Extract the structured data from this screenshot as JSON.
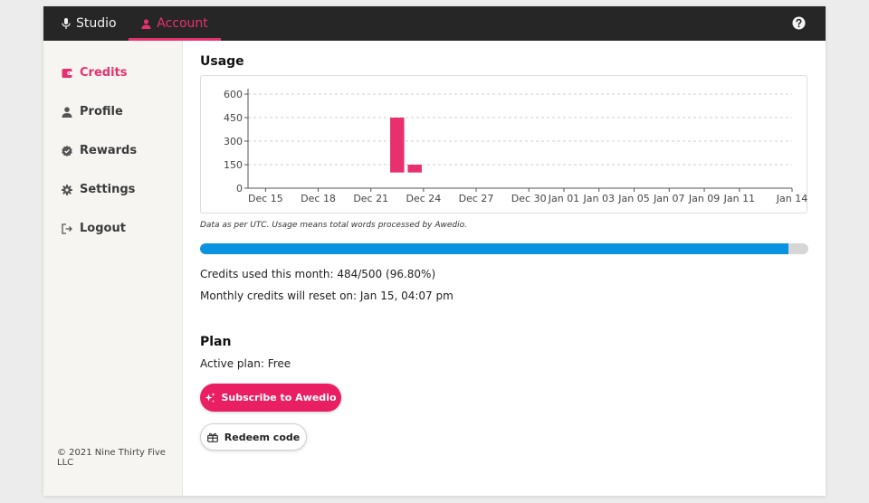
{
  "topbar": {
    "tabs": [
      {
        "label": "Studio",
        "icon": "microphone-icon"
      },
      {
        "label": "Account",
        "icon": "person-icon",
        "active": true
      }
    ],
    "help_icon": "help-icon"
  },
  "sidebar": {
    "items": [
      {
        "label": "Credits",
        "icon": "wallet-icon",
        "active": true
      },
      {
        "label": "Profile",
        "icon": "person-icon"
      },
      {
        "label": "Rewards",
        "icon": "badge-check-icon"
      },
      {
        "label": "Settings",
        "icon": "gear-icon"
      },
      {
        "label": "Logout",
        "icon": "logout-icon"
      }
    ],
    "copyright": "© 2021 Nine Thirty Five LLC"
  },
  "usage": {
    "title": "Usage",
    "note": "Data as per UTC. Usage means total words processed by Awedio.",
    "progress": {
      "used": 484,
      "total": 500,
      "percent": 96.8
    },
    "credits_used": "Credits used this month: 484/500 (96.80%)",
    "reset": "Monthly credits will reset on: Jan 15, 04:07 pm"
  },
  "plan": {
    "title": "Plan",
    "active_label": "Active plan:",
    "active_value": "Free",
    "subscribe_label": "Subscribe to Awedio",
    "redeem_label": "Redeem code"
  },
  "colors": {
    "accent": "#e8306e",
    "button": "#e91e63",
    "progress": "#0a93e0",
    "topbar": "#262626"
  },
  "chart_data": {
    "type": "bar",
    "x_ticks": [
      "Dec 15",
      "Dec 18",
      "Dec 21",
      "Dec 24",
      "Dec 27",
      "Dec 30",
      "Jan 01",
      "Jan 03",
      "Jan 05",
      "Jan 07",
      "Jan 09",
      "Jan 11",
      "Jan 14"
    ],
    "y_ticks": [
      0,
      150,
      300,
      450,
      600
    ],
    "ylim": [
      0,
      600
    ],
    "xlim": [
      "Dec 14",
      "Jan 14"
    ],
    "grid": true,
    "bars": [
      {
        "date": "Dec 22",
        "value": 450,
        "base": 100
      },
      {
        "date": "Dec 23",
        "value": 150,
        "base": 100
      }
    ]
  }
}
